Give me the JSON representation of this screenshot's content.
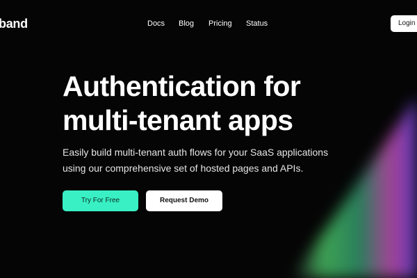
{
  "nav": {
    "logo": "band",
    "links": [
      "Docs",
      "Blog",
      "Pricing",
      "Status"
    ],
    "login_label": "Login"
  },
  "hero": {
    "title_lines": [
      "Authentication for",
      "multi-tenant apps"
    ],
    "subtitle_lines": [
      "Easily build multi-tenant auth flows for your SaaS applications",
      "using our comprehensive set of hosted pages and APIs."
    ],
    "primary_cta": "Try For Free",
    "secondary_cta": "Request Demo"
  },
  "colors": {
    "background": "#050505",
    "accent": "#38f0c4",
    "glow_green": "#4fd36b",
    "glow_pink": "#d64fb8",
    "glow_blue": "#5a3fd0"
  }
}
